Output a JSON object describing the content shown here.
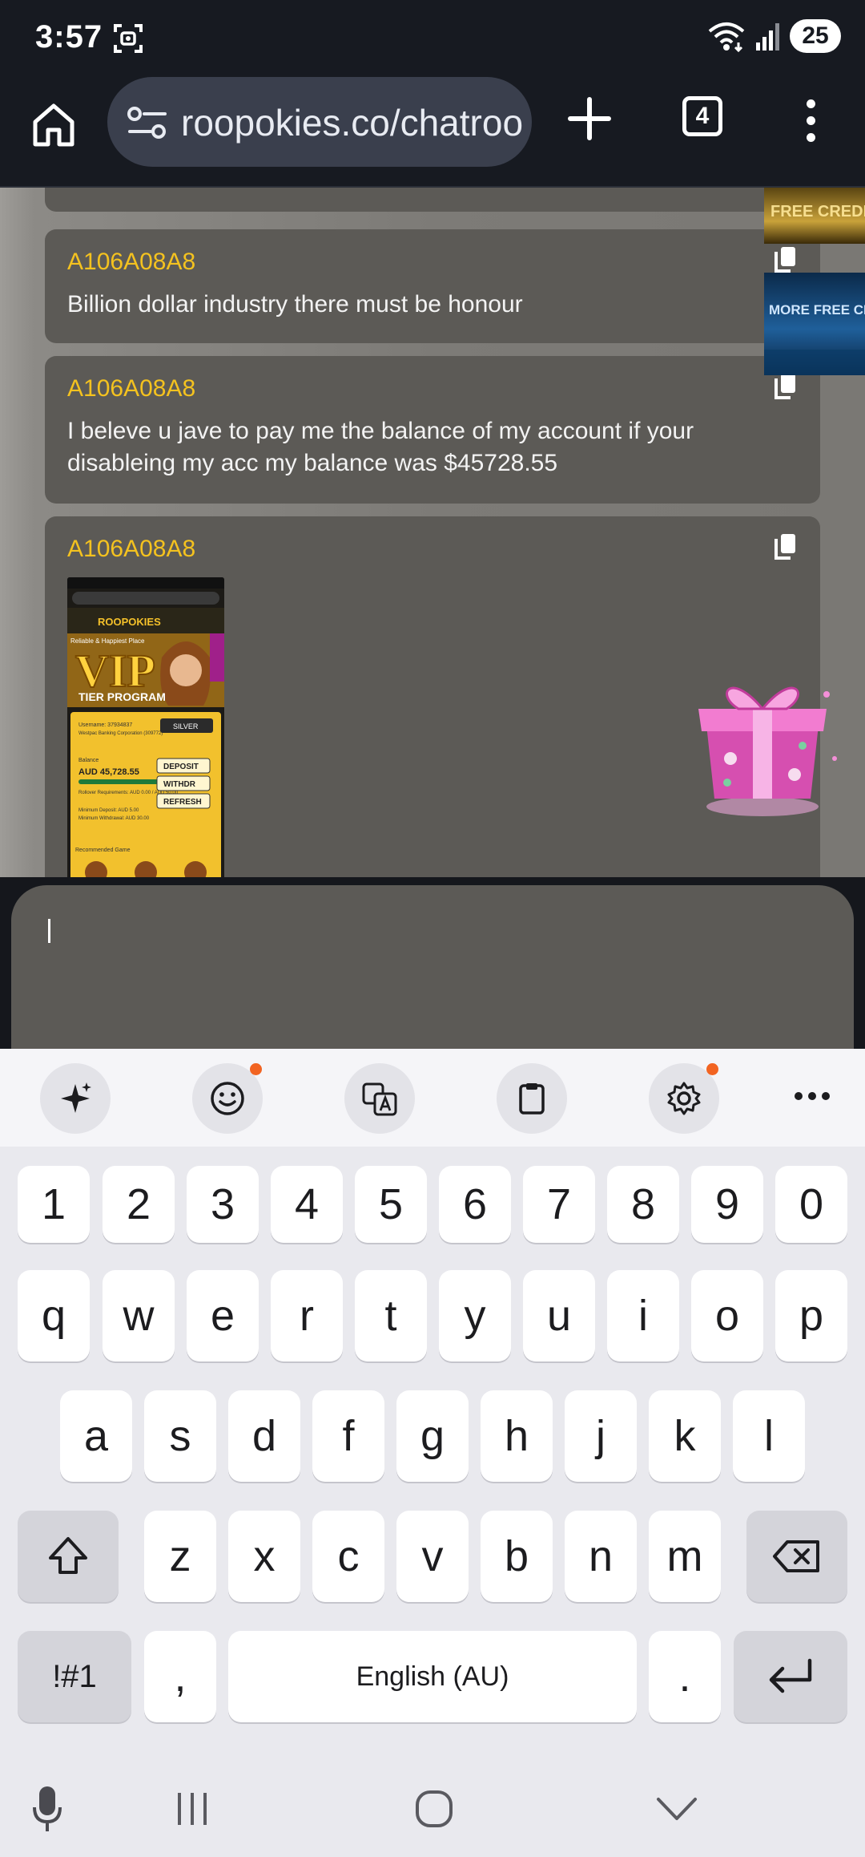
{
  "status_bar": {
    "time": "3:57",
    "battery": "25"
  },
  "browser": {
    "url": "roopokies.co/chatroom",
    "tab_count": "4"
  },
  "chat": {
    "messages": [
      {
        "user": "A106A08A8",
        "text": "Billion dollar industry there must be honour"
      },
      {
        "user": "A106A08A8",
        "text": "I beleve u jave to pay me the balance of my account if your disableing my acc my balance was $45728.55"
      },
      {
        "user": "A106A08A8",
        "text": ""
      }
    ],
    "screenshot_thumbnail": {
      "brand": "ROOPOKIES",
      "tagline": "Reliable & Happiest Place",
      "banner_title": "VIP",
      "banner_subtitle": "TIER PROGRAM",
      "tier": "SILVER",
      "username_label": "Username: 37934837",
      "account_name": "Westpac Banking Corporation (309772)",
      "balance_label": "Balance",
      "balance": "AUD 45,728.55",
      "rollover_label": "Rollover Requirements: AUD 0.00 / AUD 50.00",
      "min_deposit": "Minimum Deposit: AUD 5.00",
      "min_withdraw": "Minimum Withdrawal: AUD 30.00",
      "deposit_button": "DEPOSIT",
      "withdraw_button": "WITHDR",
      "refresh_button": "REFRESH",
      "section_label": "Recommended Game"
    },
    "promo_banners": [
      {
        "label": "FREE CREDIT"
      },
      {
        "label": "MORE FREE CREDIT"
      }
    ]
  },
  "input": {
    "value": ""
  },
  "keyboard": {
    "number_row": [
      "1",
      "2",
      "3",
      "4",
      "5",
      "6",
      "7",
      "8",
      "9",
      "0"
    ],
    "row1": [
      "q",
      "w",
      "e",
      "r",
      "t",
      "y",
      "u",
      "i",
      "o",
      "p"
    ],
    "row2": [
      "a",
      "s",
      "d",
      "f",
      "g",
      "h",
      "j",
      "k",
      "l"
    ],
    "row3": [
      "z",
      "x",
      "c",
      "v",
      "b",
      "n",
      "m"
    ],
    "symbols_key": "!#1",
    "comma_key": ",",
    "space_label": "English (AU)",
    "period_key": "."
  }
}
